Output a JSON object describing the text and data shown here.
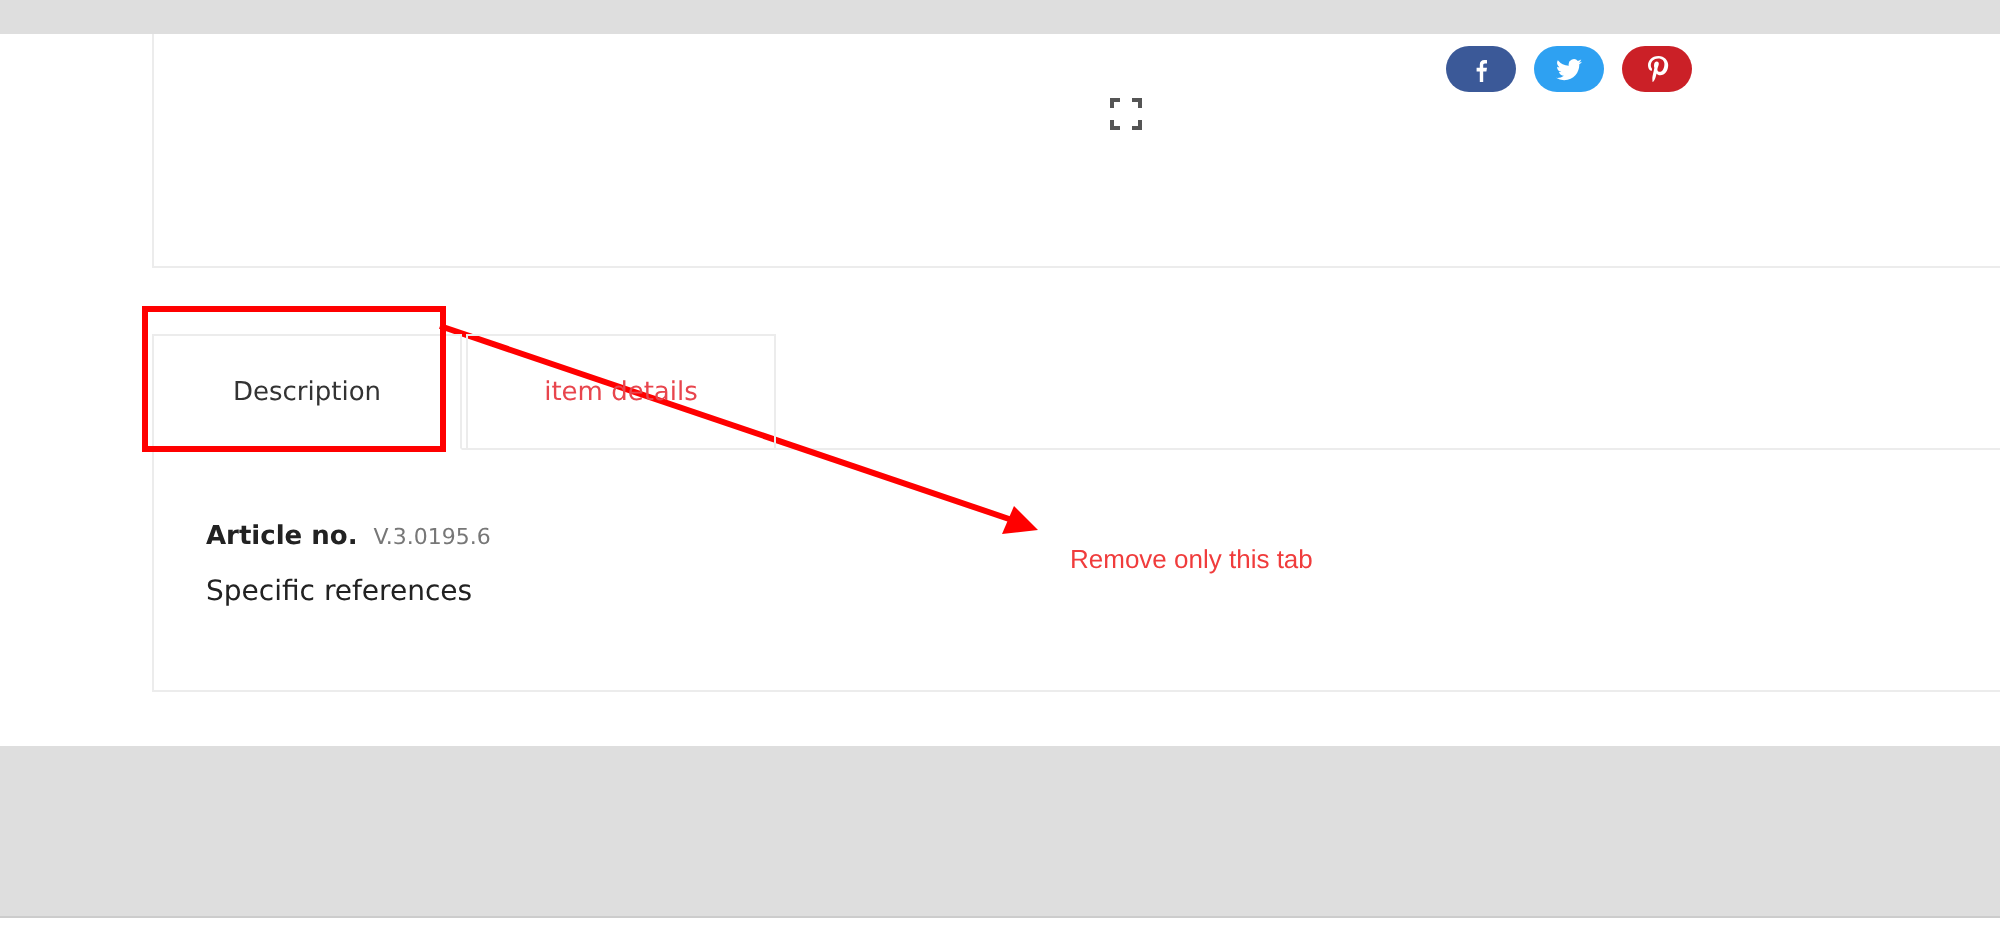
{
  "share_buttons": [
    {
      "kind": "facebook",
      "color": "#3b5998"
    },
    {
      "kind": "twitter",
      "color": "#2ea1f2"
    },
    {
      "kind": "pinterest",
      "color": "#cb2027"
    }
  ],
  "tabs": [
    {
      "label": "Description",
      "selected": true
    },
    {
      "label": "item details",
      "selected": false
    }
  ],
  "details": {
    "article_label": "Article no.",
    "article_value": "V.3.0195.6",
    "references": "Specific references"
  },
  "annotation": {
    "text": "Remove only this tab"
  }
}
